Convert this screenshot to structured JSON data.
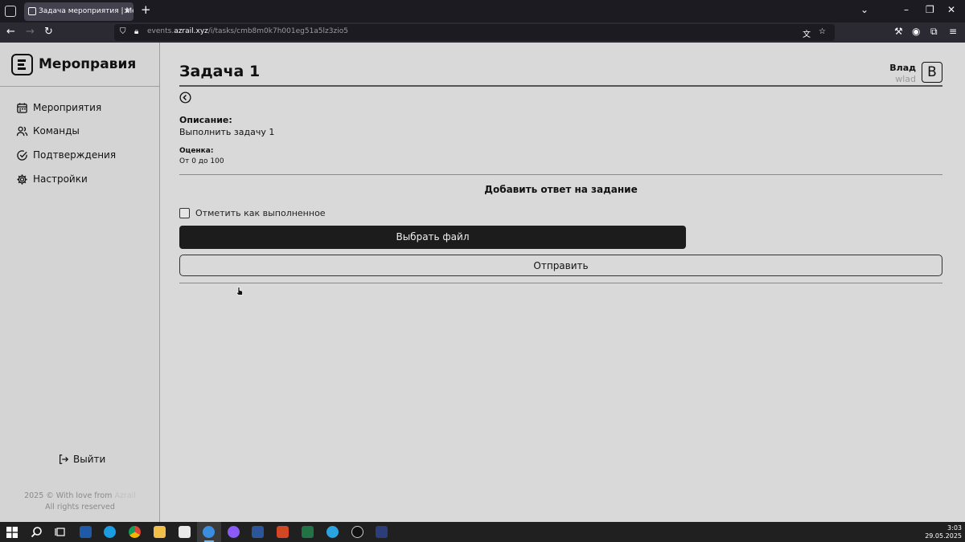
{
  "browser": {
    "tab_title": "Задача мероприятия | Мероп...",
    "url_prefix": "events.",
    "url_domain": "azrail.xyz",
    "url_path": "/i/tasks/cmb8m0k7h001eg51a5lz3zio5"
  },
  "sidebar": {
    "brand": "Мероправия",
    "items": [
      {
        "label": "Мероприятия",
        "icon": "calendar-icon"
      },
      {
        "label": "Команды",
        "icon": "users-icon"
      },
      {
        "label": "Подтверждения",
        "icon": "check-circle-icon"
      },
      {
        "label": "Настройки",
        "icon": "gear-icon"
      }
    ],
    "logout_label": "Выйти",
    "footer_line1": "2025 © With love from ",
    "footer_link": "Azrail",
    "footer_line2": "All rights reserved"
  },
  "header": {
    "title": "Задача 1",
    "user_name": "Влад",
    "user_login": "wlad",
    "avatar_letter": "В"
  },
  "task": {
    "description_label": "Описание:",
    "description_value": "Выполнить задачу 1",
    "grade_label": "Оценка:",
    "grade_value": "От 0 до 100"
  },
  "answer": {
    "section_title": "Добавить ответ на задание",
    "checkbox_label": "Отметить как выполненное",
    "checkbox_checked": false,
    "file_button": "Выбрать файл",
    "submit_button": "Отправить"
  },
  "taskbar": {
    "time": "3:03",
    "date": "29.05.2025"
  },
  "colors": {
    "page_bg": "#d9d9d9",
    "sidebar_bg": "#d4d4d4",
    "primary_button": "#1c1c1c"
  }
}
